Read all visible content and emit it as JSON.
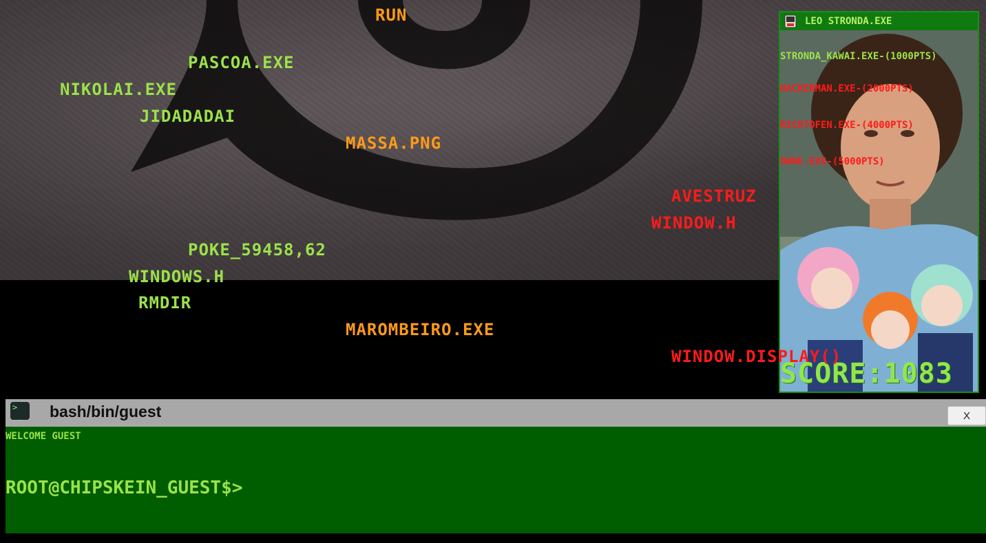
{
  "background": {
    "symbol_icon": "spiral-leaf-symbol-icon"
  },
  "words": [
    {
      "text": "RUN",
      "color": "#ff9a1a"
    },
    {
      "text": "PASCOA.EXE",
      "color": "#9be24a"
    },
    {
      "text": "NIKOLAI.EXE",
      "color": "#9be24a"
    },
    {
      "text": "JIDADADAI",
      "color": "#9be24a"
    },
    {
      "text": "MASSA.PNG",
      "color": "#ff9a1a"
    },
    {
      "text": "AVESTRUZ",
      "color": "#ff1b1b"
    },
    {
      "text": "WINDOW.H",
      "color": "#ff1b1b"
    },
    {
      "text": "POKE_59458,62",
      "color": "#9be24a"
    },
    {
      "text": "WINDOWS.H",
      "color": "#9be24a"
    },
    {
      "text": "RMDIR",
      "color": "#9be24a"
    },
    {
      "text": "MAROMBEIRO.EXE",
      "color": "#ff9a1a"
    },
    {
      "text": "WINDOW.DISPLAY()",
      "color": "#ff1b1b"
    }
  ],
  "panel": {
    "title": "LEO STRONDA.EXE",
    "app_icon": "retro-computer-icon",
    "bonuses": [
      {
        "text": "STRONDA_KAWAI.EXE-(1000PTS)",
        "color": "#9be24a"
      },
      {
        "text": "HACKERMAN.EXE-(2000PTS)",
        "color": "#ff1b1b"
      },
      {
        "text": "RICHTOFEN.EXE-(4000PTS)",
        "color": "#ff1b1b"
      },
      {
        "text": "OWNE.EXE-(5000PTS)",
        "color": "#ff1b1b"
      }
    ],
    "score": "SCORE:1083"
  },
  "terminal": {
    "icon": "terminal-icon",
    "title": "bash/bin/guest",
    "close_label": "X",
    "welcome": "WELCOME GUEST",
    "prompt": "ROOT@CHIPSKEIN_GUEST$>",
    "input_value": ""
  },
  "colors": {
    "green_text": "#9be24a",
    "orange_text": "#ff9a1a",
    "red_text": "#ff1b1b",
    "terminal_bg": "#005e00",
    "titlebar_gray": "#a8a8a8"
  }
}
